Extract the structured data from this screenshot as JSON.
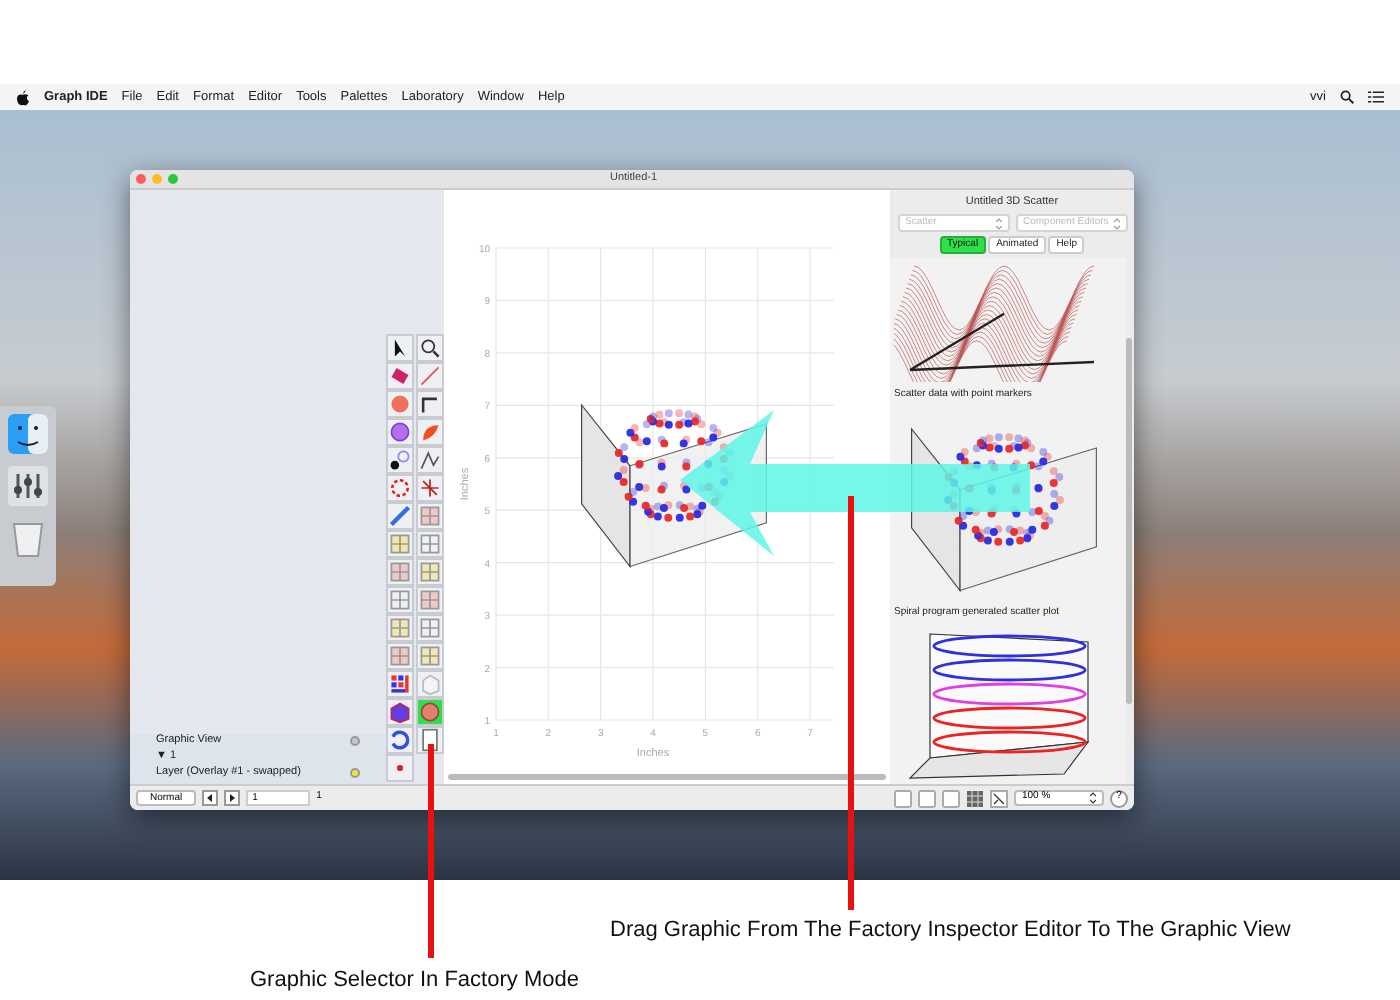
{
  "menubar": {
    "app": "Graph IDE",
    "menus": [
      "File",
      "Edit",
      "Format",
      "Editor",
      "Tools",
      "Palettes",
      "Laboratory",
      "Window",
      "Help"
    ],
    "user": "vvi"
  },
  "window": {
    "title": "Untitled-1"
  },
  "sidebar": {
    "rows": [
      {
        "label": "Graphic View",
        "color": "#c4c8cc"
      },
      {
        "label": "▼ 1"
      },
      {
        "label": "Layer (Overlay #1 - swapped)",
        "color": "#f2e23a"
      }
    ]
  },
  "tool_palette": [
    {
      "selected": false
    },
    {
      "selected": false
    },
    {
      "selected": false
    },
    {
      "selected": false
    },
    {
      "selected": false
    },
    {
      "selected": false
    },
    {
      "selected": false
    },
    {
      "selected": false
    },
    {
      "selected": false
    },
    {
      "selected": false
    },
    {
      "selected": false
    },
    {
      "selected": false
    },
    {
      "selected": false
    },
    {
      "selected": false
    },
    {
      "selected": false
    },
    {
      "selected": false
    },
    {
      "selected": false
    },
    {
      "selected": false
    },
    {
      "selected": false
    },
    {
      "selected": false
    },
    {
      "selected": false
    },
    {
      "selected": false
    },
    {
      "selected": false
    },
    {
      "selected": false
    },
    {
      "selected": false
    },
    {
      "selected": false
    },
    {
      "selected": false
    },
    {
      "selected": true
    },
    {
      "selected": false
    },
    {
      "selected": false
    },
    {
      "selected": false
    }
  ],
  "canvas": {
    "x_ticks": [
      "1",
      "2",
      "3",
      "4",
      "5",
      "6",
      "7"
    ],
    "y_ticks": [
      "10",
      "9",
      "8",
      "7",
      "6",
      "5",
      "4",
      "3",
      "2",
      "1"
    ],
    "x_label": "Inches",
    "y_label": "Inches"
  },
  "inspector": {
    "title": "Untitled 3D Scatter",
    "selects": [
      {
        "label": "Scatter",
        "disabled": true
      },
      {
        "label": "Component Editors",
        "disabled": true
      }
    ],
    "tabs": [
      {
        "label": "Typical",
        "selected": true
      },
      {
        "label": "Animated",
        "selected": false
      },
      {
        "label": "Help",
        "selected": false
      }
    ],
    "examples": [
      {
        "kind": "surface"
      },
      {
        "kind": "scatter",
        "caption": "Scatter data with point markers"
      },
      {
        "kind": "spiral",
        "caption": "Spiral program generated scatter plot"
      }
    ]
  },
  "bottom_bar": {
    "mode": "Normal",
    "page_field": "1",
    "page_count": "1",
    "zoom": "100 %",
    "help": "?"
  },
  "annotations": [
    {
      "text": "Drag Graphic From The Factory Inspector Editor To The Graphic View"
    },
    {
      "text": "Graphic Selector In Factory Mode"
    }
  ]
}
